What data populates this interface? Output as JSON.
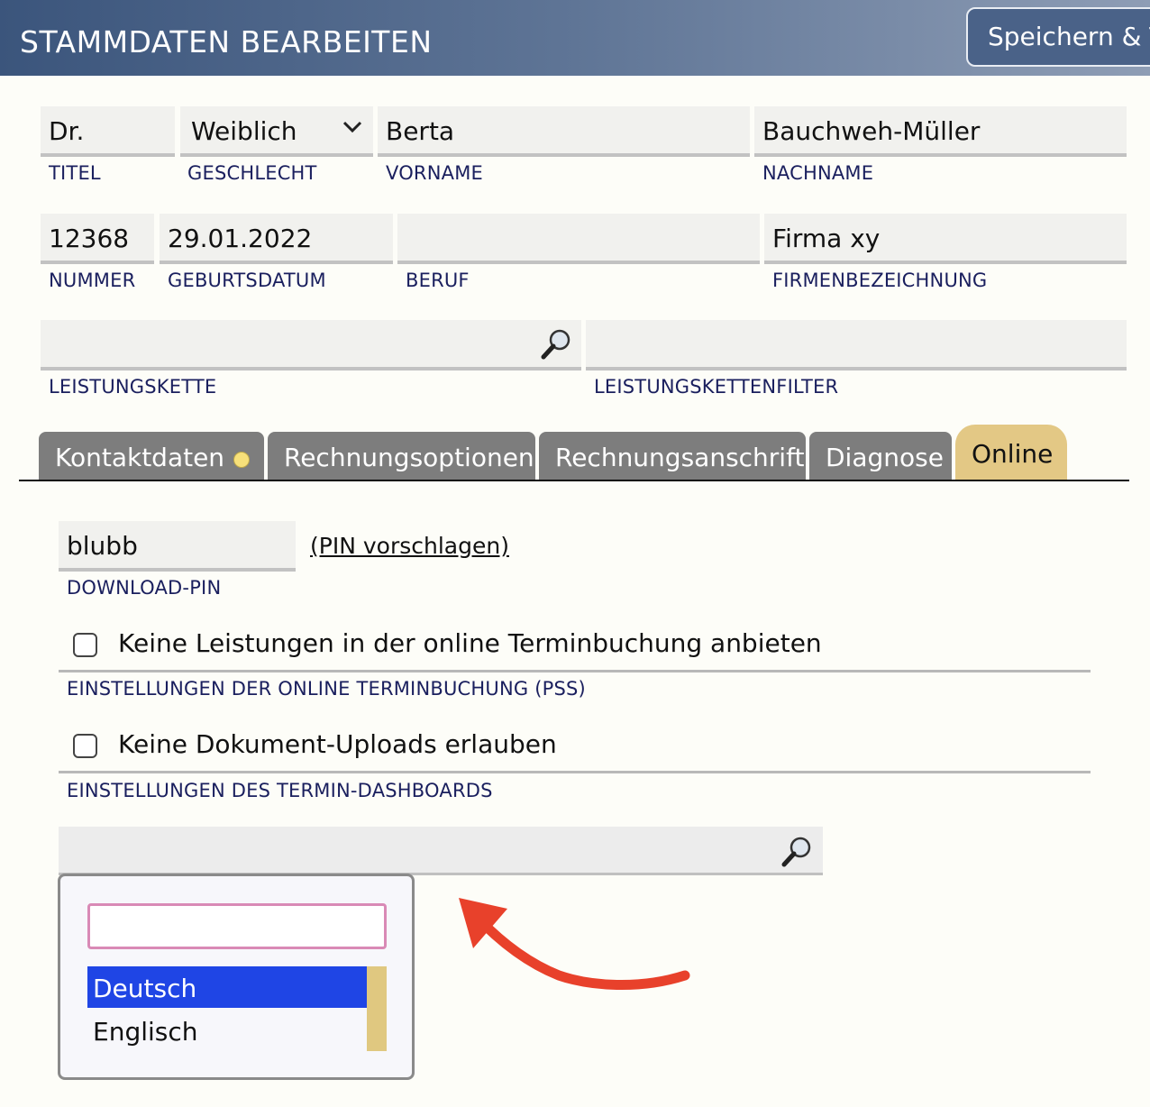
{
  "header": {
    "title": "STAMMDATEN BEARBEITEN",
    "save_label": "Speichern & Te"
  },
  "fields": {
    "titel": {
      "value": "Dr.",
      "label": "TITEL"
    },
    "geschlecht": {
      "value": "Weiblich",
      "label": "GESCHLECHT"
    },
    "vorname": {
      "value": "Berta",
      "label": "VORNAME"
    },
    "nachname": {
      "value": "Bauchweh-Müller",
      "label": "NACHNAME"
    },
    "nummer": {
      "value": "12368",
      "label": "NUMMER"
    },
    "geburtsdatum": {
      "value": "29.01.2022",
      "label": "GEBURTSDATUM"
    },
    "beruf": {
      "value": "",
      "label": "BERUF"
    },
    "firma": {
      "value": "Firma xy",
      "label": "FIRMENBEZEICHNUNG"
    },
    "leistungskette": {
      "value": "",
      "label": "LEISTUNGSKETTE"
    },
    "leistungskettenfilter": {
      "value": "",
      "label": "LEISTUNGSKETTENFILTER"
    }
  },
  "tabs": [
    {
      "label": "Kontaktdaten"
    },
    {
      "label": "Rechnungsoptionen"
    },
    {
      "label": "Rechnungsanschrift"
    },
    {
      "label": "Diagnose"
    },
    {
      "label": "Online"
    }
  ],
  "online": {
    "pin": {
      "value": "blubb",
      "label": "DOWNLOAD-PIN",
      "suggest_link": "(PIN vorschlagen)"
    },
    "pss": {
      "checkbox_text": "Keine Leistungen in der online Terminbuchung anbieten",
      "label": "EINSTELLUNGEN DER ONLINE TERMINBUCHUNG (PSS)",
      "checked": false
    },
    "dashboard": {
      "checkbox_text": "Keine Dokument-Uploads erlauben",
      "label": "EINSTELLUNGEN DES TERMIN-DASHBOARDS",
      "checked": false
    },
    "language_dropdown": {
      "search_value": "",
      "options": [
        "Deutsch",
        "Englisch"
      ],
      "selected": "Deutsch"
    }
  },
  "colors": {
    "header_start": "#3b557c",
    "tab_active": "#e3c885",
    "tab_inactive": "#7d7d7d",
    "label_text": "#1a1f5e",
    "selected_option": "#1f45e5",
    "annotation_arrow": "#e8412b"
  }
}
